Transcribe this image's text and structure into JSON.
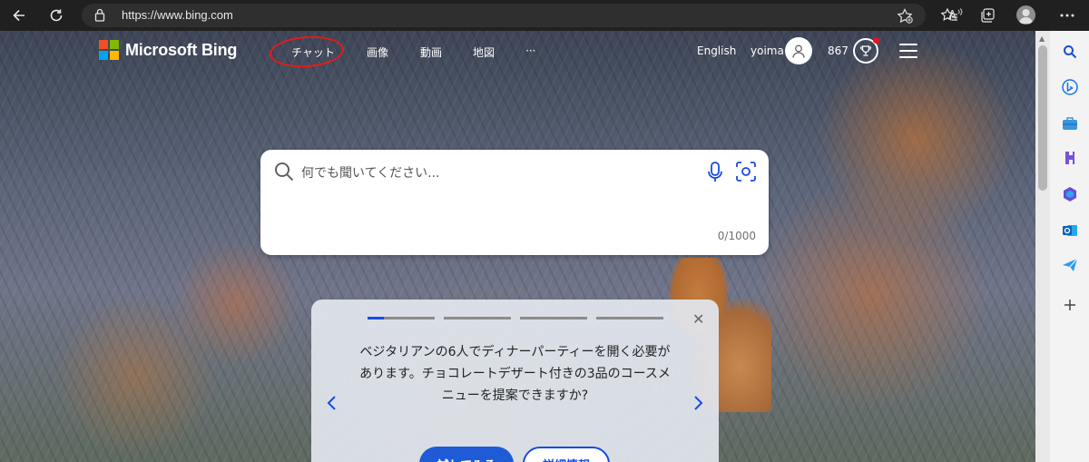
{
  "browser": {
    "url": "https://www.bing.com",
    "read_aloud_icon": "A’"
  },
  "bing": {
    "logo_text": "Microsoft Bing",
    "tabs": [
      "チャット",
      "画像",
      "動画",
      "地図",
      "···"
    ],
    "language": "English",
    "username": "yoima",
    "points": "867"
  },
  "search": {
    "placeholder": "何でも聞いてください...",
    "counter": "0/1000"
  },
  "card": {
    "text": "ベジタリアンの6人でディナーパーティーを開く必要があります。チョコレートデザート付きの3品のコースメニューを提案できますか?",
    "try_button": "試してみる",
    "details_button": "詳細情報"
  },
  "colors": {
    "accent": "#174ae4",
    "highlight_circle": "#e41b1b"
  }
}
